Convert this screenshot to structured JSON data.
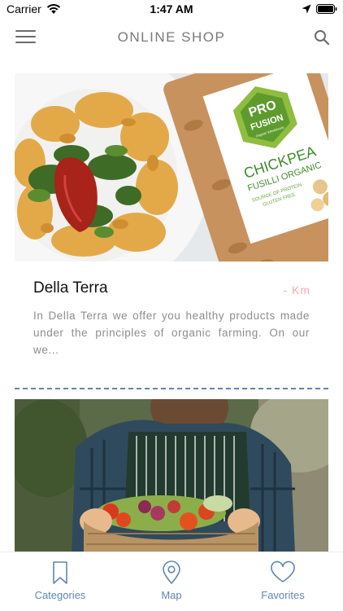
{
  "status_bar": {
    "carrier": "Carrier",
    "time": "1:47 AM"
  },
  "header": {
    "title": "ONLINE SHOP",
    "menu_icon": "hamburger-menu-icon",
    "search_icon": "search-icon"
  },
  "shops": [
    {
      "name": "Della Terra",
      "distance": "- Km",
      "description": "In Della Terra we offer you healthy products made under the principles of organic farming. On our we...",
      "image": {
        "brand_top": "PRO",
        "brand_bottom": "FUSION",
        "brand_tag": "Organic Wholefoods",
        "product": "CHICKPEA",
        "product_sub": "FUSILLI ORGANIC",
        "claim_1": "SOURCE OF PROTEIN",
        "claim_2": "GLUTEN FREE"
      }
    },
    {
      "name": "",
      "distance": "",
      "description": ""
    }
  ],
  "tab_bar": {
    "tabs": [
      {
        "label": "Categories",
        "icon": "bookmark-icon"
      },
      {
        "label": "Map",
        "icon": "map-pin-icon"
      },
      {
        "label": "Favorites",
        "icon": "heart-icon"
      }
    ]
  },
  "colors": {
    "accent": "#5f86b3",
    "distance": "#f4aab4",
    "title_gray": "#7a7a7a",
    "description_gray": "#8d8d8d",
    "divider": "#5f86b3"
  }
}
